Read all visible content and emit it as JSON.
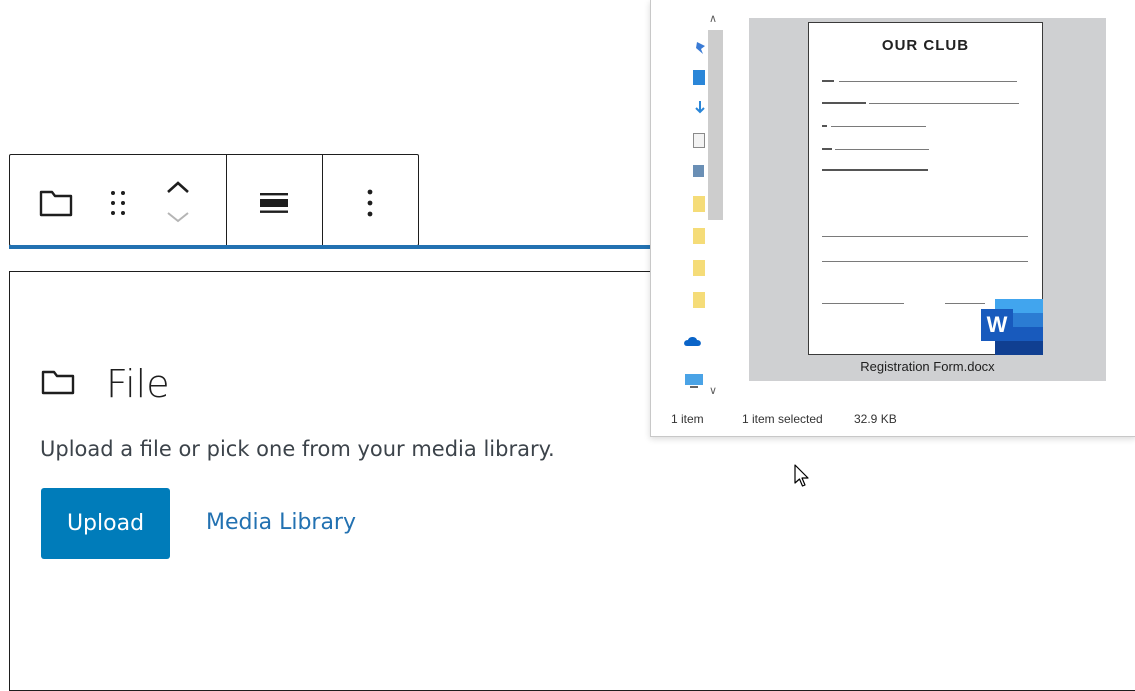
{
  "toolbar": {
    "block_type_icon": "folder-icon",
    "drag_icon": "drag-handle-icon",
    "move_up_icon": "chevron-up-icon",
    "move_down_icon": "chevron-down-icon",
    "align_icon": "align-none-icon",
    "options_icon": "more-vertical-icon"
  },
  "file_block": {
    "icon": "folder-icon",
    "title": "File",
    "instructions": "Upload a file or pick one from your media library.",
    "upload_label": "Upload",
    "media_library_label": "Media Library"
  },
  "explorer": {
    "preview": {
      "document_title": "OUR CLUB"
    },
    "file_name": "Registration Form.docx",
    "status": {
      "item_count": "1 item",
      "selected": "1 item selected",
      "size": "32.9 KB"
    }
  },
  "colors": {
    "accent": "#007cba",
    "link": "#2271b1",
    "word_blue": "#185abd"
  }
}
